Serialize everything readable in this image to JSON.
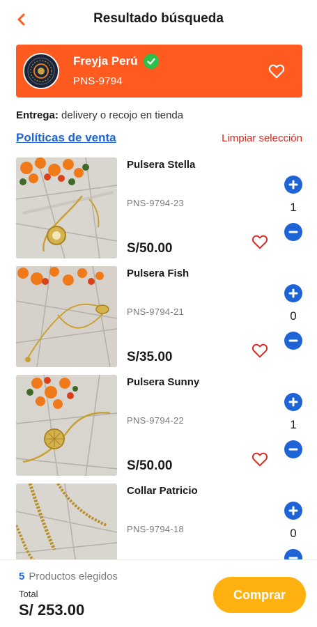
{
  "header": {
    "title": "Resultado búsqueda"
  },
  "store": {
    "name": "Freyja Perú",
    "code": "PNS-9794"
  },
  "delivery": {
    "label": "Entrega:",
    "value": " delivery o recojo en tienda"
  },
  "links": {
    "policies": "Políticas de venta",
    "clear": "Limpiar selección"
  },
  "products": [
    {
      "name": "Pulsera Stella",
      "code": "PNS-9794-23",
      "price": "S/50.00",
      "qty": "1"
    },
    {
      "name": "Pulsera Fish",
      "code": "PNS-9794-21",
      "price": "S/35.00",
      "qty": "0"
    },
    {
      "name": "Pulsera Sunny",
      "code": "PNS-9794-22",
      "price": "S/50.00",
      "qty": "1"
    },
    {
      "name": "Collar Patricio",
      "code": "PNS-9794-18",
      "price": "",
      "qty": "0"
    }
  ],
  "footer": {
    "count": "5",
    "count_label": "Productos elegidos",
    "total_label": "Total",
    "total": "S/ 253.00",
    "buy": "Comprar"
  },
  "colors": {
    "accent": "#ff5a1f",
    "blue": "#1e64d6",
    "red": "#d7261e",
    "button": "#ffb20f"
  },
  "icons": {
    "back": "chevron-left-icon",
    "verified": "check-badge-icon",
    "favorite": "heart-outline-icon",
    "plus": "plus-circle-icon",
    "minus": "minus-circle-icon"
  }
}
